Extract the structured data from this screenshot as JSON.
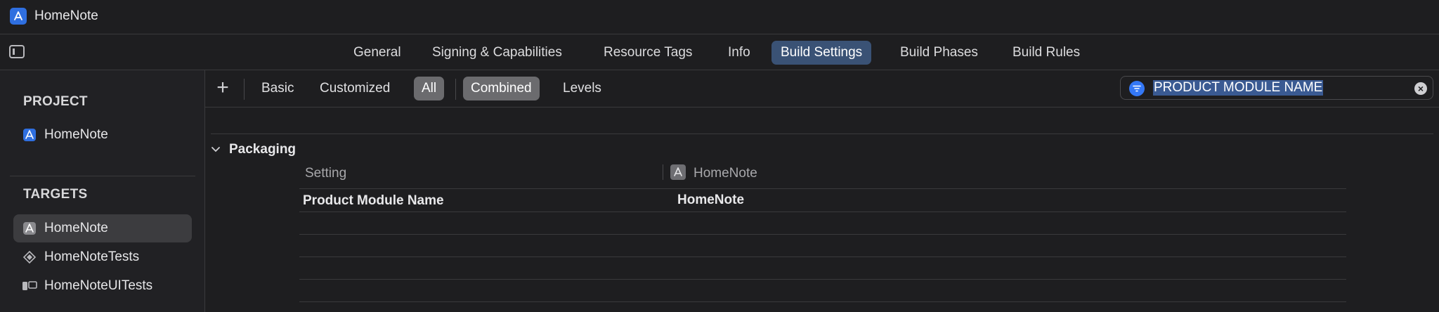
{
  "window": {
    "title": "HomeNote"
  },
  "tabs": [
    "General",
    "Signing & Capabilities",
    "Resource Tags",
    "Info",
    "Build Settings",
    "Build Phases",
    "Build Rules"
  ],
  "active_tab": "Build Settings",
  "sidebar": {
    "project_header": "PROJECT",
    "project_item": "HomeNote",
    "targets_header": "TARGETS",
    "targets": [
      "HomeNote",
      "HomeNoteTests",
      "HomeNoteUITests"
    ]
  },
  "filterbar": {
    "scope_buttons": [
      "Basic",
      "Customized",
      "All"
    ],
    "view_buttons": [
      "Combined",
      "Levels"
    ],
    "search_value": "PRODUCT MODULE NAME"
  },
  "settings": {
    "group_title": "Packaging",
    "column_setting": "Setting",
    "column_target": "HomeNote",
    "row_name": "Product Module Name",
    "row_value": "HomeNote"
  },
  "colors": {
    "accent": "#3478f6",
    "active_tab": "#3a5275",
    "background": "#1e1e20"
  }
}
